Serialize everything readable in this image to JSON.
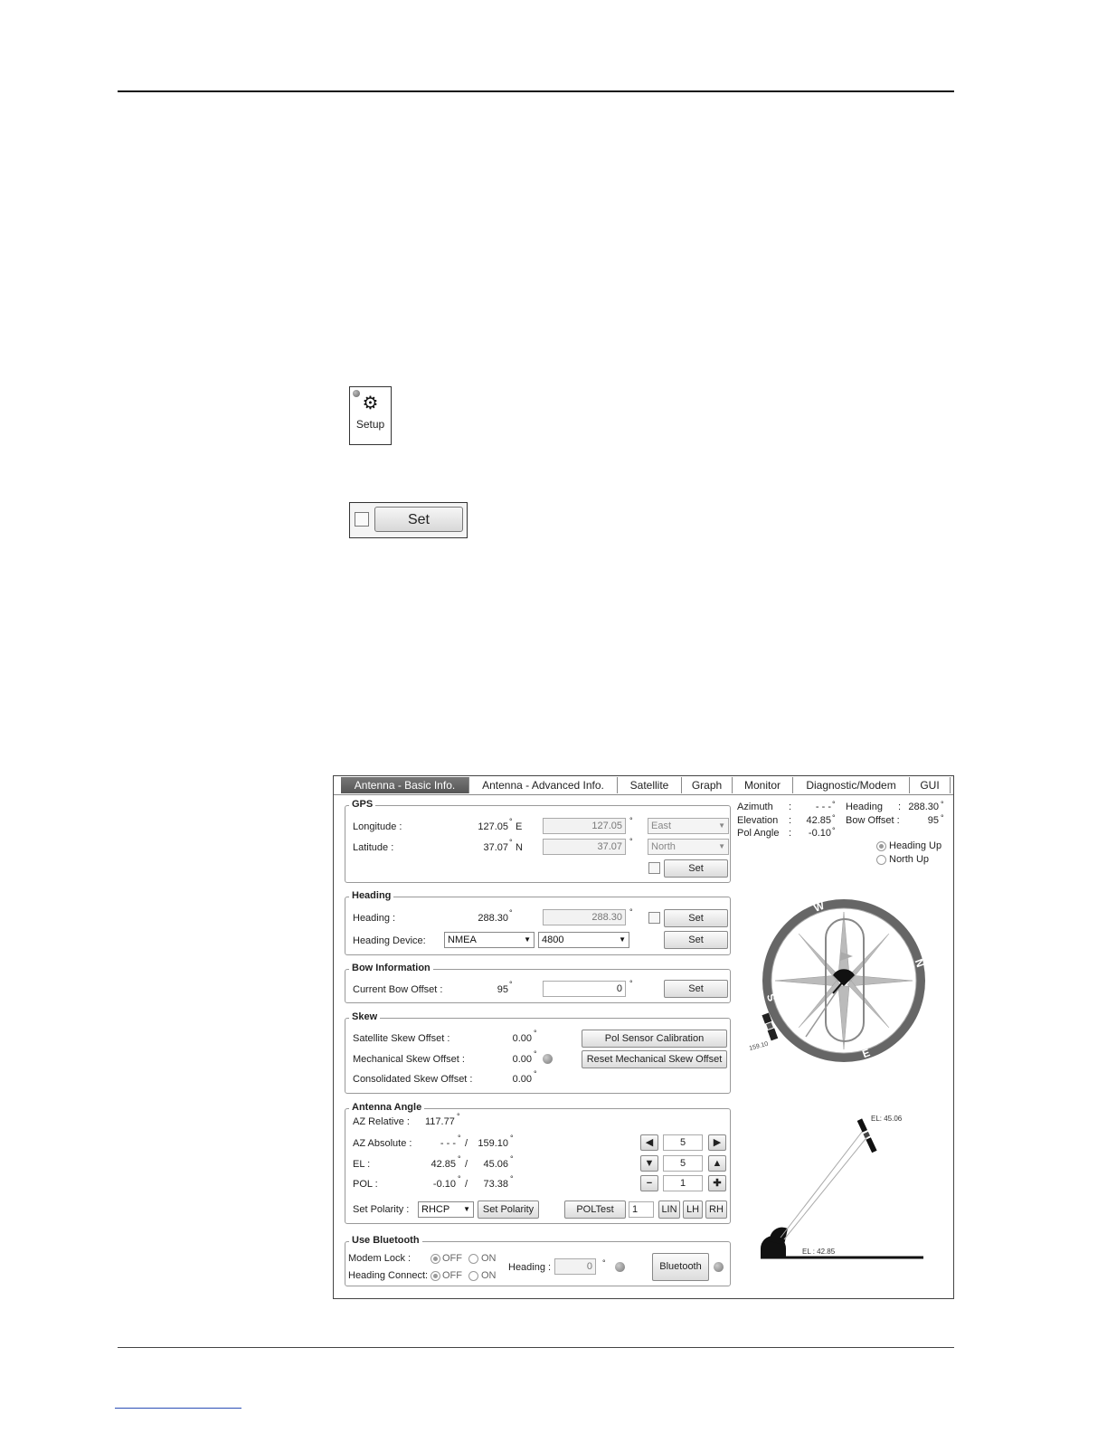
{
  "setup_icon": {
    "label": "Setup"
  },
  "set_snippet": {
    "label": "Set"
  },
  "tabs": [
    {
      "label": "Antenna - Basic Info.",
      "active": true
    },
    {
      "label": "Antenna - Advanced Info."
    },
    {
      "label": "Satellite"
    },
    {
      "label": "Graph"
    },
    {
      "label": "Monitor"
    },
    {
      "label": "Diagnostic/Modem"
    },
    {
      "label": "GUI"
    }
  ],
  "gps": {
    "title": "GPS",
    "longitude_label": "Longitude :",
    "longitude_value": "127.05",
    "longitude_unit": "E",
    "latitude_label": "Latitude :",
    "latitude_value": "37.07",
    "latitude_unit": "N",
    "longitude_input": "127.05",
    "latitude_input": "37.07",
    "longitude_dir": "East",
    "latitude_dir": "North",
    "set_label": "Set"
  },
  "heading": {
    "title": "Heading",
    "heading_label": "Heading :",
    "heading_value": "288.30",
    "heading_input": "288.30",
    "device_label": "Heading Device:",
    "device_value": "NMEA",
    "baud_value": "4800",
    "set_label": "Set",
    "set2_label": "Set"
  },
  "bow": {
    "title": "Bow Information",
    "offset_label": "Current Bow Offset :",
    "offset_value": "95",
    "offset_input": "0",
    "set_label": "Set"
  },
  "skew": {
    "title": "Skew",
    "sat_label": "Satellite Skew Offset :",
    "sat_value": "0.00",
    "mech_label": "Mechanical Skew Offset :",
    "mech_value": "0.00",
    "cons_label": "Consolidated Skew Offset :",
    "cons_value": "0.00",
    "pol_btn": "Pol Sensor Calibration",
    "reset_btn": "Reset Mechanical Skew Offset"
  },
  "antenna": {
    "title": "Antenna Angle",
    "az_rel_label": "AZ Relative :",
    "az_rel_value": "117.77",
    "az_abs_label": "AZ Absolute :",
    "az_abs_value": "- - -",
    "az_abs_target": "159.10",
    "el_label": "EL :",
    "el_value": "42.85",
    "el_target": "45.06",
    "pol_label": "POL :",
    "pol_value": "-0.10",
    "pol_target": "73.38",
    "step_az": "5",
    "step_el": "5",
    "step_pol": "1",
    "polarity_label": "Set Polarity :",
    "polarity_value": "RHCP",
    "set_polarity_btn": "Set Polarity",
    "poltest_btn": "POLTest",
    "poltest_value": "1",
    "lin_btn": "LIN",
    "lh_btn": "LH",
    "rh_btn": "RH"
  },
  "bluetooth": {
    "title": "Use Bluetooth",
    "modem_lock_label": "Modem Lock :",
    "heading_connect_label": "Heading Connect:",
    "off_label": "OFF",
    "on_label": "ON",
    "heading_label": "Heading :",
    "heading_value": "0",
    "bluetooth_btn": "Bluetooth"
  },
  "status": {
    "azimuth_label": "Azimuth",
    "azimuth_value": "- - -",
    "elevation_label": "Elevation",
    "elevation_value": "42.85",
    "pol_label": "Pol Angle",
    "pol_value": "-0.10",
    "heading_label": "Heading",
    "heading_value": "288.30",
    "bow_label": "Bow Offset :",
    "bow_value": "95",
    "heading_up": "Heading Up",
    "north_up": "North Up"
  },
  "compass": {
    "n": "N",
    "e": "E",
    "s": "S",
    "w": "W",
    "sat_az": "159.10"
  },
  "elev_diagram": {
    "target_label": "EL: 45.06",
    "current_label": "EL : 42.85"
  }
}
